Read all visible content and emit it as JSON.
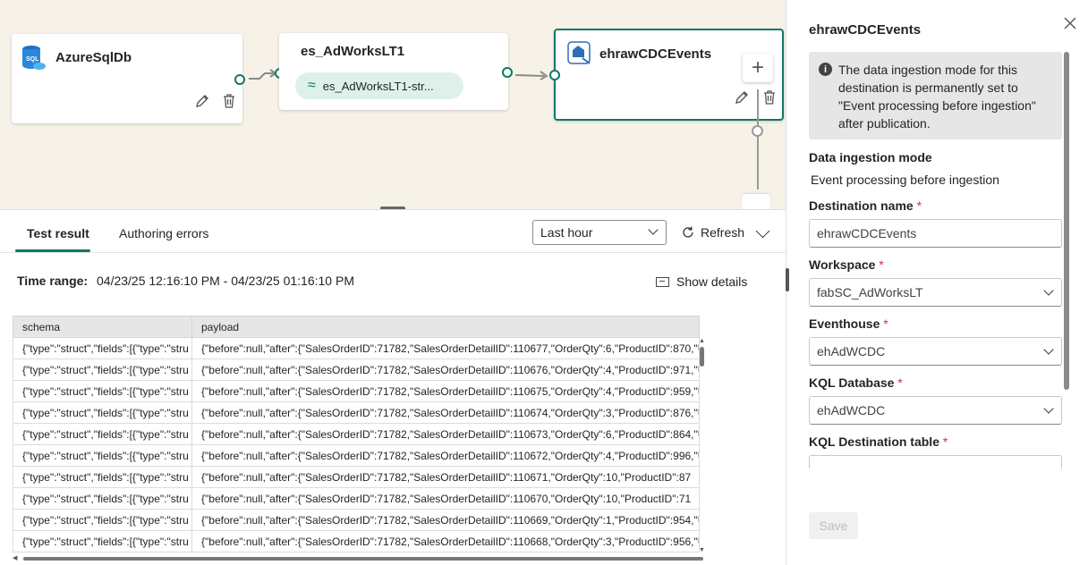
{
  "canvas": {
    "source_node": {
      "title": "AzureSqlDb",
      "icon_text": "SQL"
    },
    "stream_node": {
      "title": "es_AdWorksLT1",
      "pill_label": "es_AdWorksLT1-str..."
    },
    "dest_node": {
      "title": "ehrawCDCEvents",
      "add_label": "+"
    }
  },
  "bottom_panel": {
    "tabs": [
      {
        "label": "Test result",
        "active": true
      },
      {
        "label": "Authoring errors",
        "active": false
      }
    ],
    "time_select": "Last hour",
    "refresh_label": "Refresh",
    "time_range_label": "Time range:",
    "time_range_value": "04/23/25 12:16:10 PM - 04/23/25 01:16:10 PM",
    "show_details_label": "Show details",
    "table": {
      "columns": [
        "schema",
        "payload"
      ],
      "rows": [
        [
          "{\"type\":\"struct\",\"fields\":[{\"type\":\"stru",
          "{\"before\":null,\"after\":{\"SalesOrderID\":71782,\"SalesOrderDetailID\":110677,\"OrderQty\":6,\"ProductID\":870,\"U"
        ],
        [
          "{\"type\":\"struct\",\"fields\":[{\"type\":\"stru",
          "{\"before\":null,\"after\":{\"SalesOrderID\":71782,\"SalesOrderDetailID\":110676,\"OrderQty\":4,\"ProductID\":971,\"U"
        ],
        [
          "{\"type\":\"struct\",\"fields\":[{\"type\":\"stru",
          "{\"before\":null,\"after\":{\"SalesOrderID\":71782,\"SalesOrderDetailID\":110675,\"OrderQty\":4,\"ProductID\":959,\"U"
        ],
        [
          "{\"type\":\"struct\",\"fields\":[{\"type\":\"stru",
          "{\"before\":null,\"after\":{\"SalesOrderID\":71782,\"SalesOrderDetailID\":110674,\"OrderQty\":3,\"ProductID\":876,\"U"
        ],
        [
          "{\"type\":\"struct\",\"fields\":[{\"type\":\"stru",
          "{\"before\":null,\"after\":{\"SalesOrderID\":71782,\"SalesOrderDetailID\":110673,\"OrderQty\":6,\"ProductID\":864,\"U"
        ],
        [
          "{\"type\":\"struct\",\"fields\":[{\"type\":\"stru",
          "{\"before\":null,\"after\":{\"SalesOrderID\":71782,\"SalesOrderDetailID\":110672,\"OrderQty\":4,\"ProductID\":996,\"U"
        ],
        [
          "{\"type\":\"struct\",\"fields\":[{\"type\":\"stru",
          "{\"before\":null,\"after\":{\"SalesOrderID\":71782,\"SalesOrderDetailID\":110671,\"OrderQty\":10,\"ProductID\":87"
        ],
        [
          "{\"type\":\"struct\",\"fields\":[{\"type\":\"stru",
          "{\"before\":null,\"after\":{\"SalesOrderID\":71782,\"SalesOrderDetailID\":110670,\"OrderQty\":10,\"ProductID\":71"
        ],
        [
          "{\"type\":\"struct\",\"fields\":[{\"type\":\"stru",
          "{\"before\":null,\"after\":{\"SalesOrderID\":71782,\"SalesOrderDetailID\":110669,\"OrderQty\":1,\"ProductID\":954,\"U"
        ],
        [
          "{\"type\":\"struct\",\"fields\":[{\"type\":\"stru",
          "{\"before\":null,\"after\":{\"SalesOrderID\":71782,\"SalesOrderDetailID\":110668,\"OrderQty\":3,\"ProductID\":956,\"U"
        ]
      ]
    }
  },
  "side_panel": {
    "title": "ehrawCDCEvents",
    "info_text": "The data ingestion mode for this destination is permanently set to \"Event processing before ingestion\" after publication.",
    "ingestion_mode_label": "Data ingestion mode",
    "ingestion_mode_value": "Event processing before ingestion",
    "destination_name_label": "Destination name",
    "destination_name_value": "ehrawCDCEvents",
    "workspace_label": "Workspace",
    "workspace_value": "fabSC_AdWorksLT",
    "eventhouse_label": "Eventhouse",
    "eventhouse_value": "ehAdWCDC",
    "kql_db_label": "KQL Database",
    "kql_db_value": "ehAdWCDC",
    "kql_table_label": "KQL Destination table",
    "required_mark": "*",
    "save_label": "Save"
  },
  "colors": {
    "accent": "#117865",
    "canvas_bg": "#f7f2e8",
    "required": "#c4314b"
  }
}
